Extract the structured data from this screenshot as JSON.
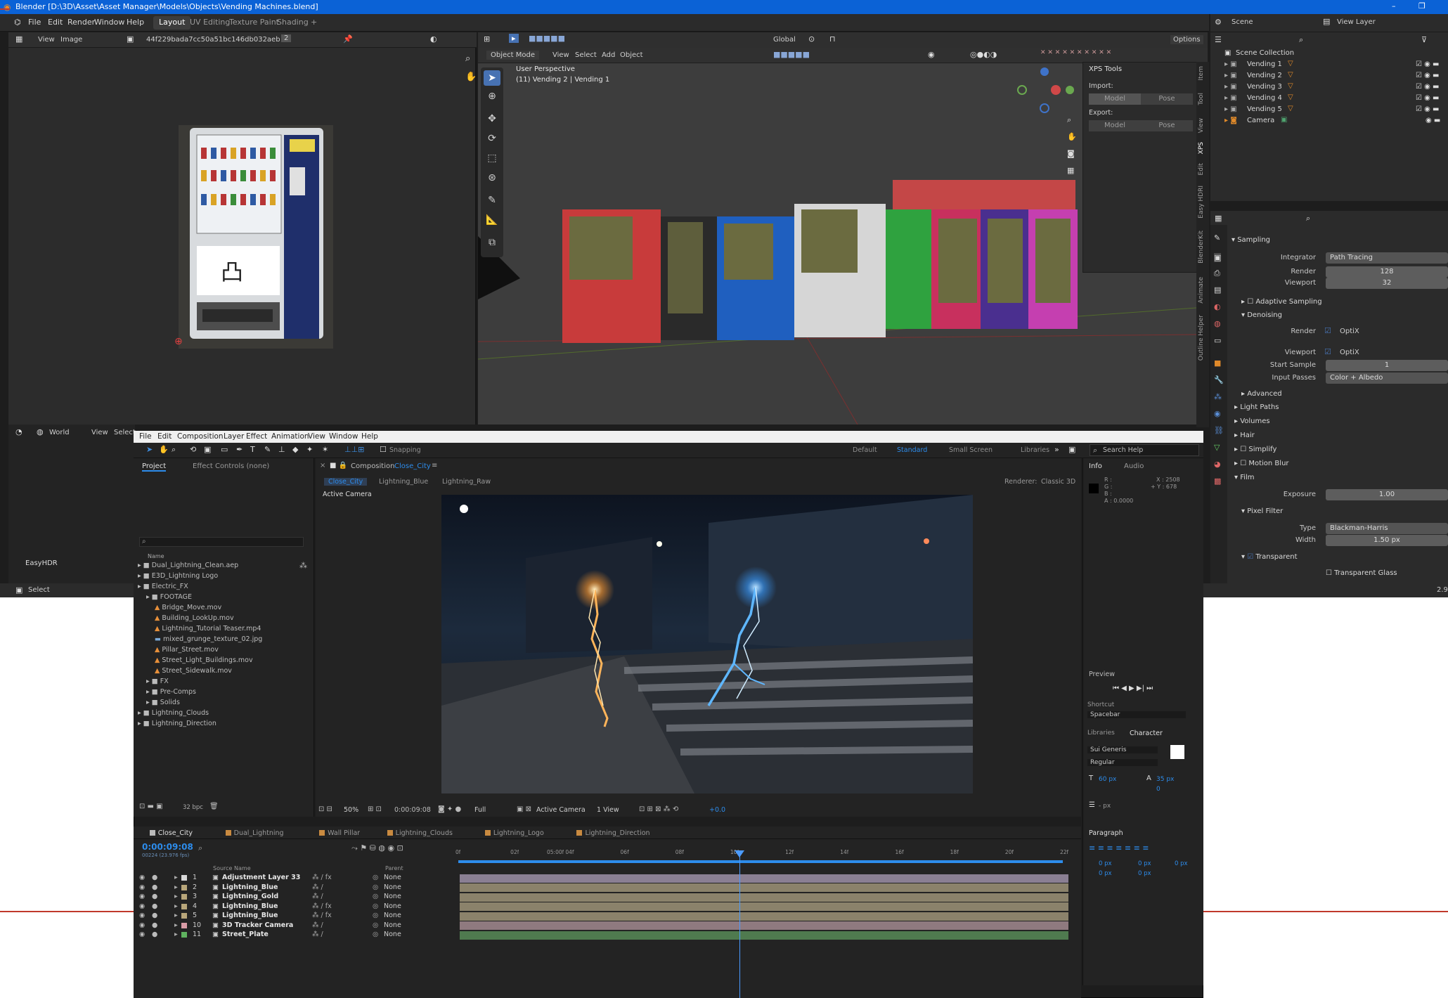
{
  "blender": {
    "title": "Blender [D:\\3D\\Asset\\Asset Manager\\Models\\Objects\\Vending Machines.blend]",
    "menu": [
      "File",
      "Edit",
      "Render",
      "Window",
      "Help"
    ],
    "workspaces": [
      "Layout",
      "UV Editing",
      "Texture Paint",
      "Shading"
    ],
    "active_workspace": "Layout",
    "image_editor": {
      "menu": [
        "View",
        "Image"
      ],
      "image_name": "44f229bada7cc50a51bc146db032aebf.jpg",
      "slot": "2"
    },
    "viewport": {
      "mode": "Object Mode",
      "menu": [
        "View",
        "Select",
        "Add",
        "Object"
      ],
      "orientation": "Global",
      "options": "Options",
      "perspective": "User Perspective",
      "selection_info": "(11) Vending 2 | Vending 1"
    },
    "xps_panel": {
      "title": "XPS Tools",
      "import_label": "Import:",
      "export_label": "Export:",
      "model": "Model",
      "pose": "Pose"
    },
    "side_tabs": [
      "Item",
      "Tool",
      "View",
      "XPS",
      "Edit",
      "Easy HDRI",
      "BlenderKit",
      "Animate",
      "Outline Helper"
    ],
    "outliner": {
      "scene": "Scene",
      "view_layer": "View Layer",
      "collection": "Scene Collection",
      "items": [
        "Vending 1",
        "Vending 2",
        "Vending 3",
        "Vending 4",
        "Vending 5",
        "Camera"
      ]
    },
    "properties": {
      "sampling": "Sampling",
      "integrator_label": "Integrator",
      "integrator": "Path Tracing",
      "render_label": "Render",
      "render_samples": "128",
      "viewport_label": "Viewport",
      "viewport_samples": "32",
      "adaptive_sampling": "Adaptive Sampling",
      "denoising": "Denoising",
      "denoise_render_label": "Render",
      "denoise_render": "OptiX",
      "denoise_viewport_label": "Viewport",
      "denoise_viewport": "OptiX",
      "start_sample_label": "Start Sample",
      "start_sample": "1",
      "input_passes_label": "Input Passes",
      "input_passes": "Color + Albedo",
      "advanced": "Advanced",
      "light_paths": "Light Paths",
      "volumes": "Volumes",
      "hair": "Hair",
      "simplify": "Simplify",
      "motion_blur": "Motion Blur",
      "film": "Film",
      "exposure_label": "Exposure",
      "exposure": "1.00",
      "pixel_filter": "Pixel Filter",
      "type_label": "Type",
      "type": "Blackman-Harris",
      "width_label": "Width",
      "width": "1.50 px",
      "transparent": "Transparent",
      "transparent_glass": "Transparent Glass"
    },
    "bottom_editor": {
      "world": "World",
      "view": "View",
      "select": "Select",
      "easyhdr": "EasyHDR"
    },
    "status": {
      "left": "Select",
      "right": "2.9"
    }
  },
  "after_effects": {
    "menu": [
      "File",
      "Edit",
      "Composition",
      "Layer",
      "Effect",
      "Animation",
      "View",
      "Window",
      "Help"
    ],
    "snapping": "Snapping",
    "workspaces": [
      "Default",
      "Standard",
      "Small Screen",
      "Libraries"
    ],
    "active_workspace": "Standard",
    "search_placeholder": "Search Help",
    "project_tab": "Project",
    "effect_controls_tab": "Effect Controls (none)",
    "name_header": "Name",
    "project_items": [
      {
        "name": "Dual_Lightning_Clean.aep",
        "indent": 0,
        "kind": "file"
      },
      {
        "name": "E3D_Lightning Logo",
        "indent": 0,
        "kind": "folder"
      },
      {
        "name": "Electric_FX",
        "indent": 0,
        "kind": "folder"
      },
      {
        "name": "FOOTAGE",
        "indent": 1,
        "kind": "folder"
      },
      {
        "name": "Bridge_Move.mov",
        "indent": 2,
        "kind": "footage"
      },
      {
        "name": "Building_LookUp.mov",
        "indent": 2,
        "kind": "footage"
      },
      {
        "name": "Lightning_Tutorial Teaser.mp4",
        "indent": 2,
        "kind": "footage"
      },
      {
        "name": "mixed_grunge_texture_02.jpg",
        "indent": 2,
        "kind": "image"
      },
      {
        "name": "Pillar_Street.mov",
        "indent": 2,
        "kind": "footage"
      },
      {
        "name": "Street_Light_Buildings.mov",
        "indent": 2,
        "kind": "footage"
      },
      {
        "name": "Street_Sidewalk.mov",
        "indent": 2,
        "kind": "footage"
      },
      {
        "name": "FX",
        "indent": 1,
        "kind": "folder"
      },
      {
        "name": "Pre-Comps",
        "indent": 1,
        "kind": "folder"
      },
      {
        "name": "Solids",
        "indent": 1,
        "kind": "folder"
      },
      {
        "name": "Lightning_Clouds",
        "indent": 0,
        "kind": "folder"
      },
      {
        "name": "Lightning_Direction",
        "indent": 0,
        "kind": "folder"
      }
    ],
    "bpc": "32 bpc",
    "composition_label": "Composition",
    "composition_name": "Close_City",
    "comp_breadcrumbs": [
      "Close_City",
      "Lightning_Blue",
      "Lightning_Raw"
    ],
    "renderer_label": "Renderer:",
    "renderer": "Classic 3D",
    "active_camera_label": "Active Camera",
    "viewer_footer": {
      "zoom": "50%",
      "timecode": "0:00:09:08",
      "resolution": "Full",
      "camera": "Active Camera",
      "views": "1 View",
      "exposure": "+0.0"
    },
    "info": {
      "tab": "Info",
      "audio_tab": "Audio",
      "r": "R :",
      "g": "G :",
      "b": "B :",
      "a": "A : 0.0000",
      "x": "X : 2508",
      "y": "+ Y : 678"
    },
    "preview": {
      "tab": "Preview",
      "shortcut_label": "Shortcut",
      "shortcut": "Spacebar"
    },
    "character": {
      "libraries_tab": "Libraries",
      "tab": "Character",
      "font": "Sui Generis",
      "style": "Regular",
      "size": "60 px",
      "leading": "35 px",
      "tracking": "0",
      "unit": "- px"
    },
    "paragraph": {
      "tab": "Paragraph",
      "indent1": "0 px",
      "indent2": "0 px",
      "indent3": "0 px",
      "space1": "0 px",
      "space2": "0 px"
    },
    "timeline_tabs": [
      "Close_City",
      "Dual_Lightning",
      "Wall Pillar",
      "Lightning_Clouds",
      "Lightning_Logo",
      "Lightning_Direction"
    ],
    "timecode": "0:00:09:08",
    "fps_note": "00224 (23.976 fps)",
    "source_name_header": "Source Name",
    "parent_header": "Parent",
    "ruler": [
      "0f",
      "02f",
      "04f",
      "06f",
      "08f",
      "10f",
      "12f",
      "14f",
      "16f",
      "18f",
      "20f",
      "22f"
    ],
    "ruler_marker": "05:00f",
    "layers": [
      {
        "num": "1",
        "name": "Adjustment Layer 33",
        "parent": "None",
        "color": "#d8d8d8",
        "bar": "#8a7f93",
        "fx": true
      },
      {
        "num": "2",
        "name": "Lightning_Blue",
        "parent": "None",
        "color": "#b8a67a",
        "bar": "#8b826b",
        "fx": false
      },
      {
        "num": "3",
        "name": "Lightning_Gold",
        "parent": "None",
        "color": "#b8a67a",
        "bar": "#8b826b",
        "fx": false
      },
      {
        "num": "4",
        "name": "Lightning_Blue",
        "parent": "None",
        "color": "#b8a67a",
        "bar": "#8b826b",
        "fx": true
      },
      {
        "num": "5",
        "name": "Lightning_Blue",
        "parent": "None",
        "color": "#b8a67a",
        "bar": "#8b826b",
        "fx": true
      },
      {
        "num": "10",
        "name": "3D Tracker Camera",
        "parent": "None",
        "color": "#d99ca6",
        "bar": "#8f7a7f",
        "fx": false
      },
      {
        "num": "11",
        "name": "Street_Plate",
        "parent": "None",
        "color": "#5fb35f",
        "bar": "#4f7a4f",
        "fx": false
      }
    ]
  },
  "colors": {
    "blender_title": "#0b62d6",
    "blender_accent": "#4772b3",
    "ae_blue": "#2d8ceb",
    "playhead": "#4b9bff"
  }
}
